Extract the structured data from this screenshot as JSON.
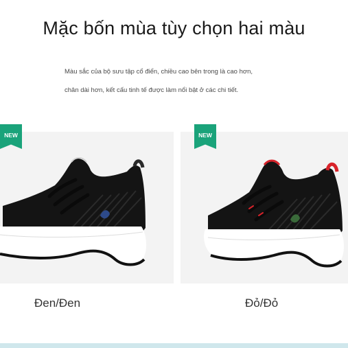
{
  "header": {
    "title": "Mặc bốn mùa tùy chọn hai màu",
    "desc_line1": "Màu sắc của bộ sưu tập cổ điển, chiều cao bên trong là cao hơn,",
    "desc_line2": "chân dài hơn, kết cấu tinh tế được làm nổi bật ở các chi tiết."
  },
  "products": [
    {
      "badge": "NEW",
      "caption": "Đen/Đen",
      "accent": "#2a2a2a"
    },
    {
      "badge": "NEW",
      "caption": "Đỏ/Đỏ",
      "accent": "#d8232a"
    }
  ],
  "colors": {
    "badge": "#1aa37a",
    "shoe_body": "#111111",
    "sole": "#ffffff",
    "card_bg": "#f3f3f3"
  }
}
